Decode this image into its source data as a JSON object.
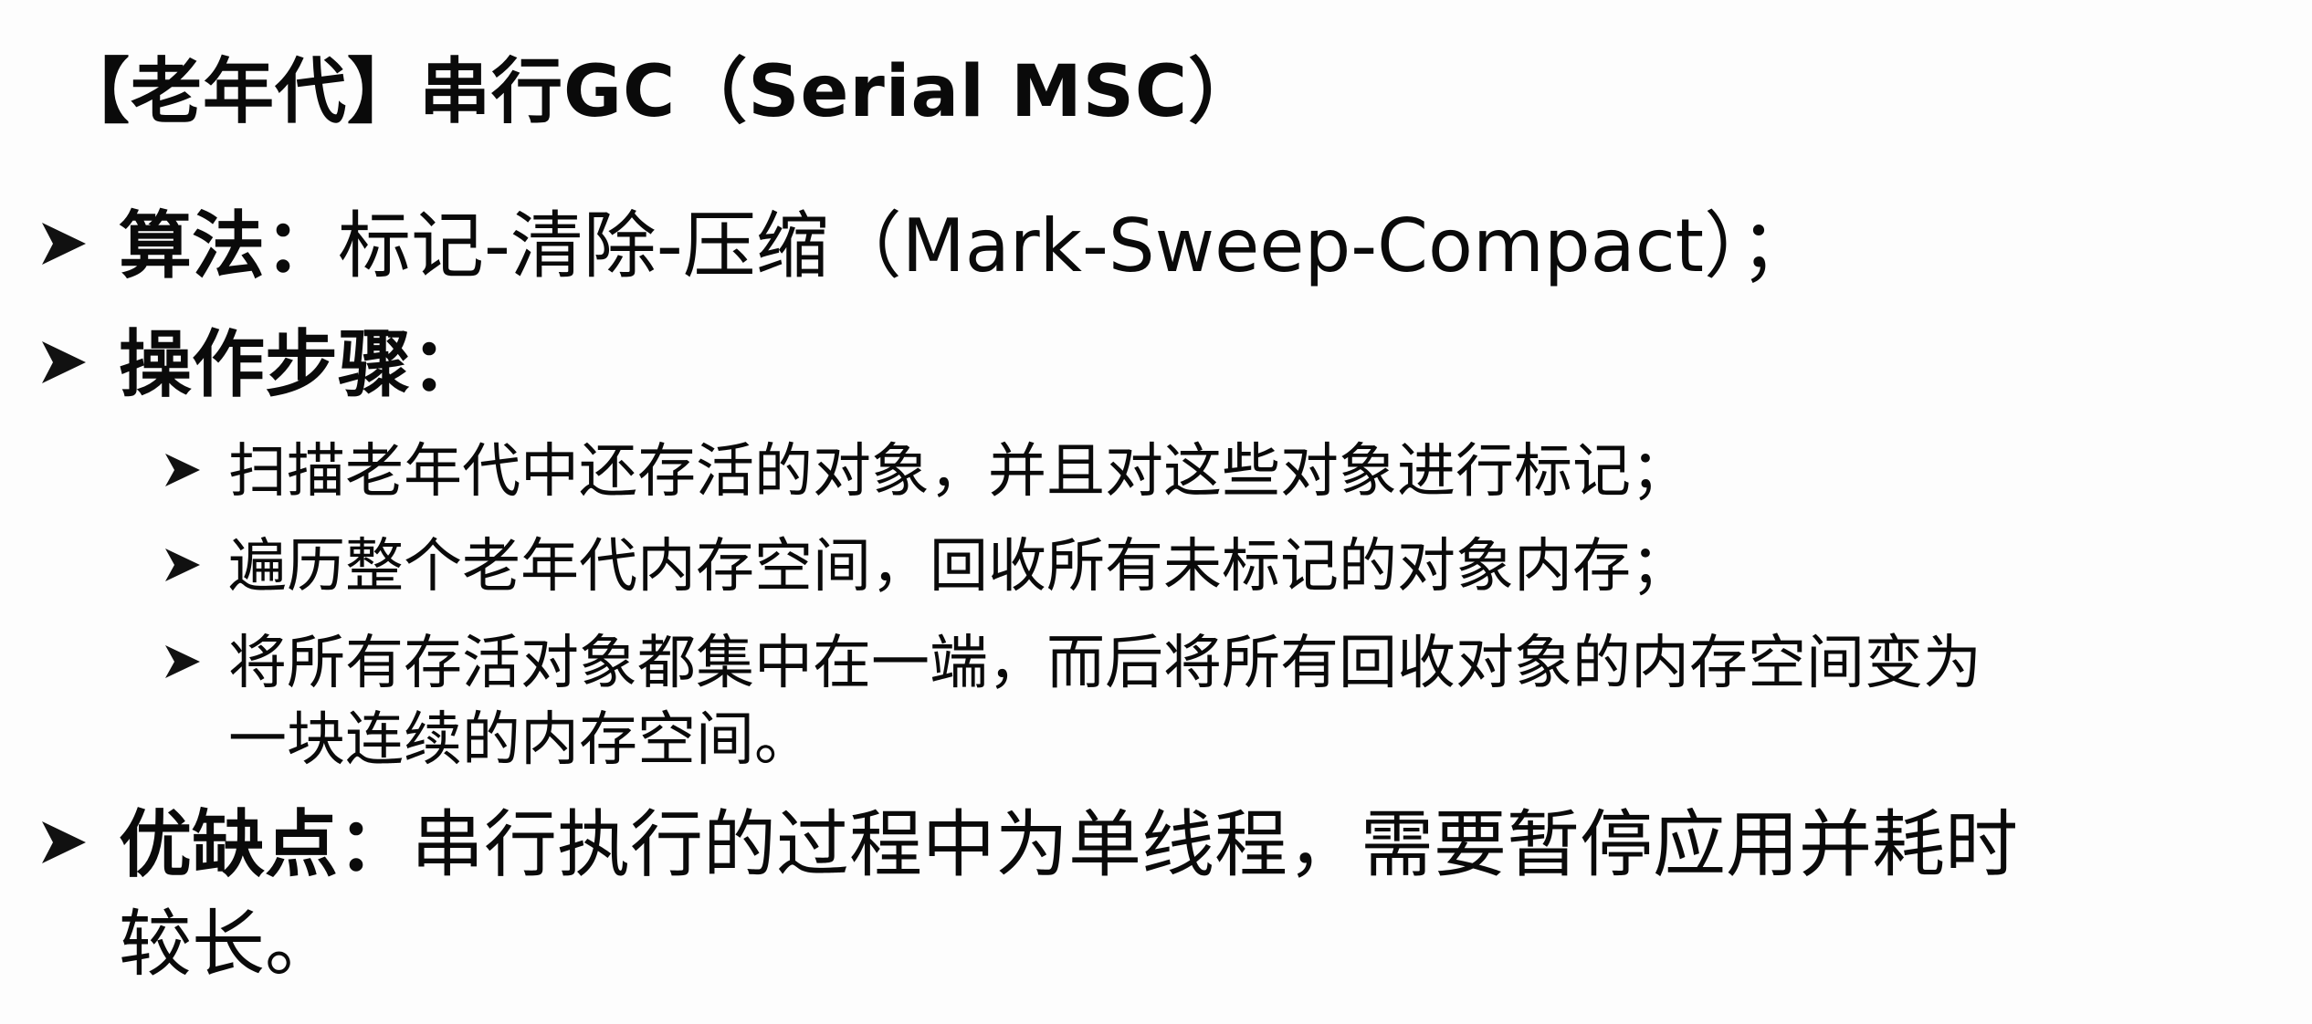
{
  "slide": {
    "title": "【老年代】串行GC（Serial MSC）",
    "items": [
      {
        "label": "算法：",
        "text": "标记-清除-压缩（Mark-Sweep-Compact）；"
      },
      {
        "label": "操作步骤：",
        "text": "",
        "subitems": [
          {
            "text": "扫描老年代中还存活的对象，并且对这些对象进行标记；"
          },
          {
            "text": "遍历整个老年代内存空间，回收所有未标记的对象内存；"
          },
          {
            "text": "将所有存活对象都集中在一端，而后将所有回收对象的内存空间变为",
            "continuation": "一块连续的内存空间。"
          }
        ]
      },
      {
        "label": "优缺点：",
        "text": "串行执行的过程中为单线程，需要暂停应用并耗时",
        "continuation": "较长。"
      }
    ]
  },
  "colors": {
    "text": "#0a0a0a",
    "background": "#fdfdfd"
  }
}
